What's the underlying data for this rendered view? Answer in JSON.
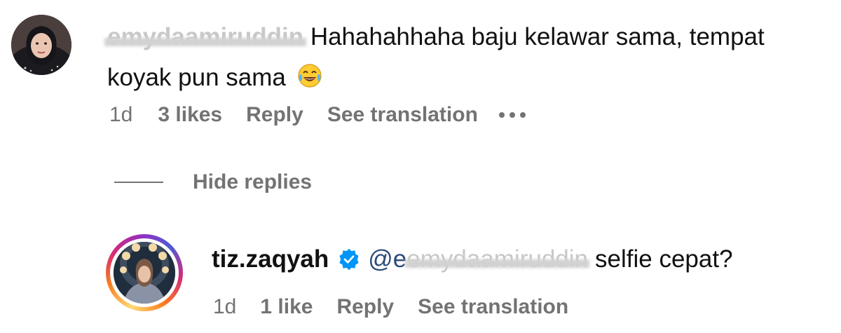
{
  "comment": {
    "username": "emydaamiruddin",
    "text": "Hahahahhaha baju kelawar sama, tempat koyak pun sama",
    "emoji": "face-with-tears-of-joy",
    "time": "1d",
    "likes": "3 likes",
    "reply_label": "Reply",
    "translate_label": "See translation",
    "more_icon": "more-horizontal-icon"
  },
  "hide_replies": {
    "label": "Hide replies"
  },
  "reply": {
    "username": "tiz.zaqyah",
    "verified": true,
    "mention_prefix": "@e",
    "mention_username": "emydaamiruddin",
    "text": "selfie cepat?",
    "time": "1d",
    "likes": "1 like",
    "reply_label": "Reply",
    "translate_label": "See translation"
  },
  "colors": {
    "meta_gray": "#737373",
    "verified_blue": "#0095f6",
    "mention_blue": "#2a4a7a",
    "story_ring": [
      "#feda75",
      "#fa7e1e",
      "#d62976",
      "#962fbf",
      "#4f5bd5"
    ]
  }
}
